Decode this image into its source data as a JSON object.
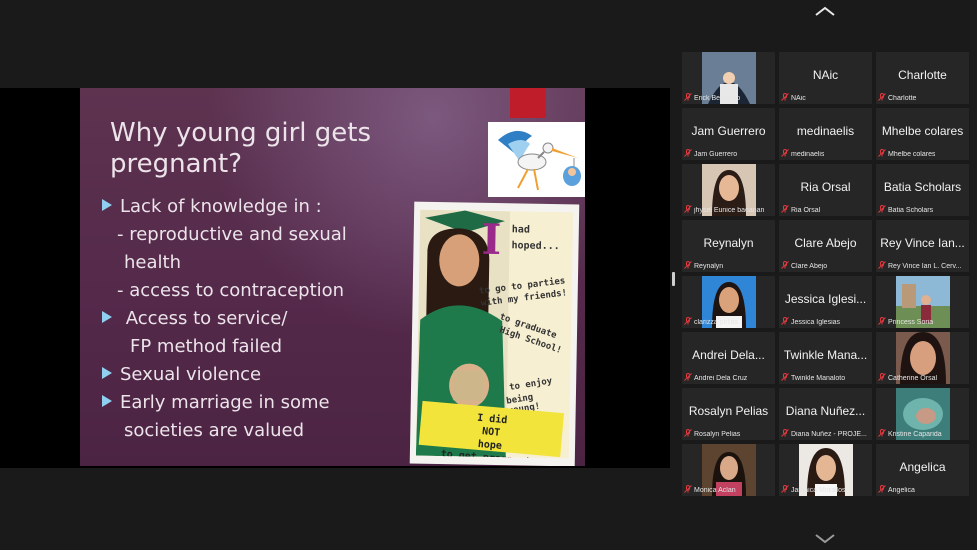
{
  "slide": {
    "title": "Why young girl gets pregnant?",
    "lines": [
      "Lack of knowledge  in :",
      "- reproductive and sexual",
      "health",
      "-  access to contraception",
      " Access to service/",
      "FP method failed",
      "Sexual violence",
      "Early marriage in some",
      "societies are valued"
    ],
    "poster": {
      "big_letter": "I",
      "had": "had",
      "hoped": "hoped...",
      "line1": "to go to parties",
      "line2": "with my friends!",
      "line3": "to graduate",
      "line4": "High School!",
      "line5": "to enjoy",
      "line6": "being young!",
      "banner1a": "I did ",
      "banner1b": "NOT",
      "banner1c": " hope",
      "banner2": "to get pregnant."
    }
  },
  "participants": [
    {
      "display": "",
      "name": "Erick Bernardo",
      "photo": "tunnel"
    },
    {
      "display": "NAic",
      "name": "NAic"
    },
    {
      "display": "Charlotte",
      "name": "Charlotte"
    },
    {
      "display": "Jam Guerrero",
      "name": "Jam Guerrero"
    },
    {
      "display": "medinaelis",
      "name": "medinaelis"
    },
    {
      "display": "Mhelbe colares",
      "name": "Mhelbe colares"
    },
    {
      "display": "",
      "name": "jhysel Eunice baoanan",
      "photo": "woman1"
    },
    {
      "display": "Ria Orsal",
      "name": "Ria Orsal"
    },
    {
      "display": "Batia Scholars",
      "name": "Batia Scholars"
    },
    {
      "display": "Reynalyn",
      "name": "Reynalyn"
    },
    {
      "display": "Clare Abejo",
      "name": "Clare Abejo"
    },
    {
      "display": "Rey Vince Ian...",
      "name": "Rey Vince Ian L. Cerv..."
    },
    {
      "display": "",
      "name": "clarizza pelias",
      "photo": "woman2"
    },
    {
      "display": "Jessica Iglesi...",
      "name": "Jessica Iglesias"
    },
    {
      "display": "",
      "name": "Princess Soria",
      "photo": "outdoor"
    },
    {
      "display": "Andrei Dela...",
      "name": "Andrei Dela Cruz"
    },
    {
      "display": "Twinkle Mana...",
      "name": "Twinkle Manaloto"
    },
    {
      "display": "",
      "name": "Catherine Orsal",
      "photo": "woman3"
    },
    {
      "display": "Rosalyn Pelias",
      "name": "Rosalyn Pelias"
    },
    {
      "display": "Diana Nuñez...",
      "name": "Diana Nuñez - PROJE..."
    },
    {
      "display": "",
      "name": "Kristine Caparida",
      "photo": "teal"
    },
    {
      "display": "",
      "name": "Monica Aclan",
      "photo": "woman4"
    },
    {
      "display": "",
      "name": "Jamaica Morallos",
      "photo": "woman5"
    },
    {
      "display": "Angelica",
      "name": "Angelica"
    }
  ],
  "icons": {
    "scroll_up": "chevron-up-icon",
    "scroll_down": "chevron-down-icon",
    "muted": "mic-muted-icon"
  },
  "colors": {
    "mute_red": "#e0393e",
    "slide_bg": "#54294a",
    "bullet": "#8fd0f0"
  }
}
